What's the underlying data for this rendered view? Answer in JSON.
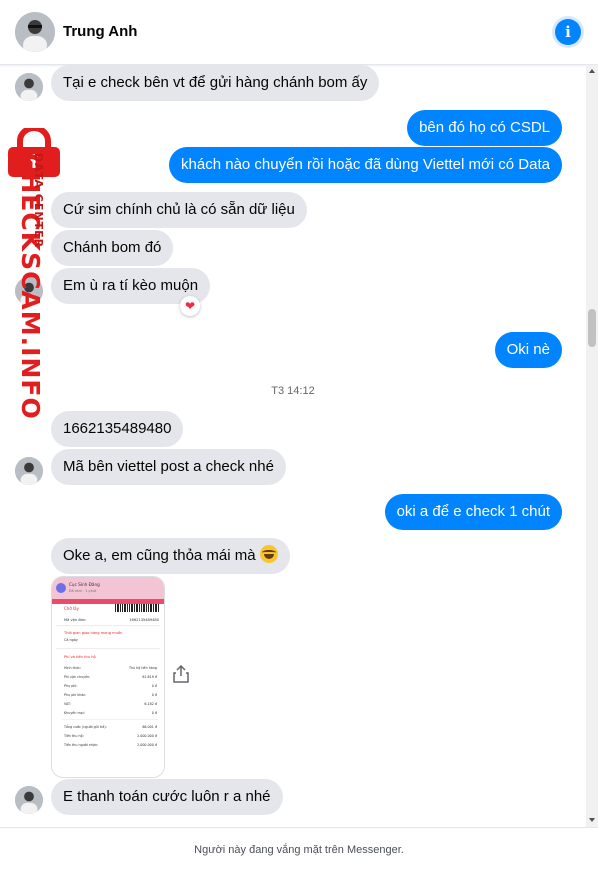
{
  "header": {
    "contact_name": "Trung Anh",
    "info_icon": "info-icon",
    "accent_color": "#0084ff"
  },
  "messages": [
    {
      "side": "in",
      "text": "Tại e check bên vt để gửi hàng chánh bom ấy"
    },
    {
      "side": "out",
      "text": "bên đó họ có CSDL"
    },
    {
      "side": "out",
      "text": "khách nào chuyển rồi hoặc đã dùng Viettel mới có Data"
    },
    {
      "side": "in",
      "text": "Cứ sim chính chủ là có sẵn dữ liệu"
    },
    {
      "side": "in",
      "text": "Chánh bom đó"
    },
    {
      "side": "in",
      "text": "Em ù ra tí kèo muộn",
      "reaction": "❤"
    },
    {
      "side": "out",
      "text": "Oki nè"
    },
    {
      "type": "timestamp",
      "text": "T3 14:12"
    },
    {
      "side": "in",
      "text": "1662135489480"
    },
    {
      "side": "in",
      "text": "Mã bên viettel post a check nhé"
    },
    {
      "side": "out",
      "text": "oki a để e check 1 chút"
    },
    {
      "side": "in",
      "text": "Oke a, em cũng thỏa mái mà",
      "emoji": "laughing-emoji"
    },
    {
      "side": "in",
      "type": "image",
      "icon": "share-icon"
    },
    {
      "side": "in",
      "text": "E thanh toán cước luôn r a nhé"
    }
  ],
  "attachment": {
    "sender": "Cục Sinh Đăng",
    "sender_sub": "Đã xem · 1 phút",
    "status": "Chờ lấy",
    "code_label": "Mã vận đơn:",
    "code": "1662135489480",
    "delivery_title": "Thời gian giao hàng mong muốn",
    "delivery_value": "Cả ngày",
    "fee_title": "Phí và tiền thu hộ",
    "rows": [
      {
        "label": "Hình thức:",
        "value": "Thu hộ tiền hàng"
      },
      {
        "label": "Phí vận chuyển:",
        "value": "61.619 đ"
      },
      {
        "label": "Phụ phí:",
        "value": "0 đ"
      },
      {
        "label": "Phụ phí khác:",
        "value": "0 đ"
      },
      {
        "label": "VAT:",
        "value": "6.182 đ"
      },
      {
        "label": "Khuyến mại:",
        "value": "0 đ"
      },
      {
        "label": "Tổng cước (người gửi trả):",
        "value": "68.001 đ"
      },
      {
        "label": "Tiền thu hộ:",
        "value": "2.000.000 đ"
      },
      {
        "label": "Tiền thu người nhận:",
        "value": "2.000.000 đ"
      }
    ]
  },
  "watermark": {
    "main": "CHECKSCAM.INFO",
    "sub": "DATA CENTER",
    "color": "#e21d1d"
  },
  "footer": {
    "text": "Người này đang vắng mặt trên Messenger."
  }
}
